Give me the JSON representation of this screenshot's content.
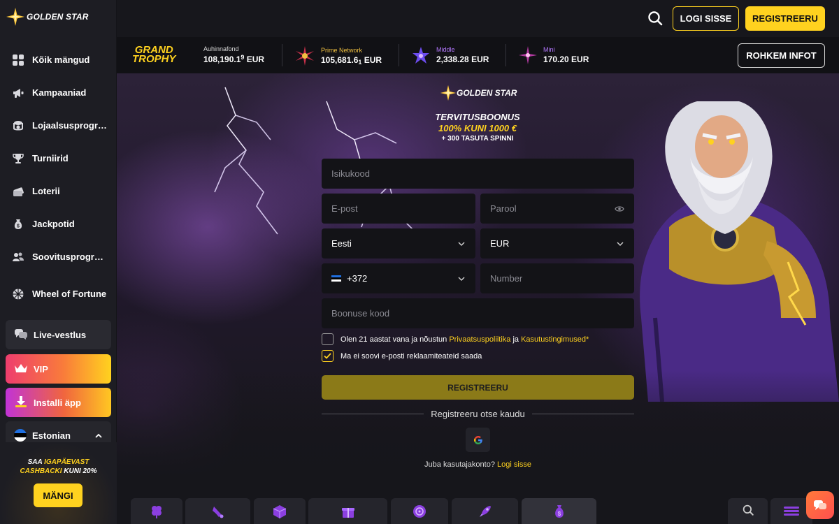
{
  "brand": {
    "name": "GOLDEN STAR"
  },
  "sidebar": {
    "items": [
      {
        "label": "Kõik mängud",
        "icon": "grid-icon"
      },
      {
        "label": "Kampaaniad",
        "icon": "megaphone-icon"
      },
      {
        "label": "Lojaalsusprogramm",
        "icon": "coin-stack-icon"
      },
      {
        "label": "Turniirid",
        "icon": "trophy-icon"
      },
      {
        "label": "Loterii",
        "icon": "tickets-icon"
      },
      {
        "label": "Jackpotid",
        "icon": "money-bag-icon"
      },
      {
        "label": "Soovitusprogramm",
        "icon": "users-icon"
      },
      {
        "label": "Wheel of Fortune",
        "icon": "wheel-icon"
      }
    ],
    "live_chat": "Live-vestlus",
    "vip": "VIP",
    "install": "Installi äpp",
    "language": "Estonian",
    "cashback": {
      "line1_white": "SAA ",
      "line1_yellow": "IGAPÄEVAST",
      "line2_yellow": "CASHBACKI",
      "line2_white": " KUNI 20%",
      "button": "MÄNGI"
    }
  },
  "header": {
    "login": "LOGI SISSE",
    "register": "REGISTREERU"
  },
  "jackpots": {
    "grand_line1": "GRAND",
    "grand_line2": "TROPHY",
    "items": [
      {
        "name": "Auhinnafond",
        "value": "108,190.1",
        "last_digit": "9",
        "currency": "EUR"
      },
      {
        "name": "Prime Network",
        "value": "105,681.6",
        "last_digit": "1",
        "currency": "EUR"
      },
      {
        "name": "Middle",
        "value": "2,338.28",
        "currency": "EUR"
      },
      {
        "name": "Mini",
        "value": "170.20",
        "currency": "EUR"
      }
    ],
    "more": "ROHKEM INFOT",
    "colors": {
      "prime": "#f0c040",
      "middle": "#b478ff",
      "mini": "#b478ff"
    }
  },
  "promo": {
    "title": "TERVITUSBOONUS",
    "offer": "100% KUNI 1000 €",
    "spins": "+ 300 TASUTA SPINNI"
  },
  "form": {
    "isikukood_placeholder": "Isikukood",
    "email_placeholder": "E-post",
    "password_placeholder": "Parool",
    "country": "Eesti",
    "currency": "EUR",
    "phone_code": "+372",
    "number_placeholder": "Number",
    "bonus_placeholder": "Boonuse kood",
    "terms_prefix": "Olen 21 aastat vana ja nõustun ",
    "privacy": "Privaatsuspoliitika",
    "terms_and": " ja ",
    "terms_link": "Kasutustingimused",
    "terms_star": "*",
    "no_email": "Ma ei soovi e-posti reklaamiteateid saada",
    "submit": "REGISTREERU",
    "register_via": "Registreeru otse kaudu",
    "have_account": "Juba kasutajakonto? ",
    "login_link": "Logi sisse"
  },
  "colors": {
    "accent": "#ffd21f",
    "sidebar": "#1d1d23",
    "bg": "#16161b"
  }
}
